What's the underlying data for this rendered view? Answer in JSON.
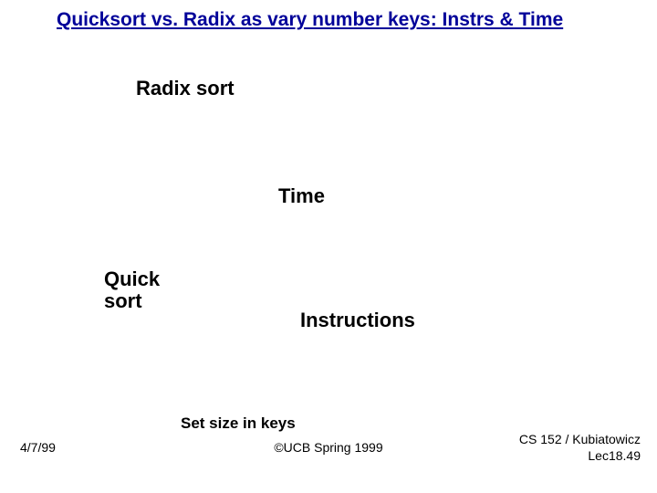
{
  "title": "Quicksort vs. Radix as vary number keys: Instrs & Time",
  "labels": {
    "radix": "Radix sort",
    "time": "Time",
    "quick_line1": "Quick",
    "quick_line2": "sort",
    "instructions": "Instructions",
    "xaxis": "Set size in keys"
  },
  "footer": {
    "date": "4/7/99",
    "center": "©UCB Spring 1999",
    "right_line1": "CS 152 / Kubiatowicz",
    "right_line2": "Lec18.49"
  }
}
